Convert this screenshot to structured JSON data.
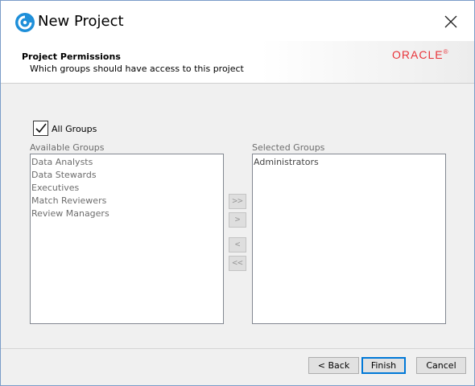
{
  "window": {
    "title": "New Project"
  },
  "header": {
    "title": "Project Permissions",
    "subtitle": "Which groups should have access to this project",
    "logo_text": "ORACLE"
  },
  "all_groups": {
    "label": "All Groups",
    "checked": true
  },
  "available": {
    "label": "Available Groups",
    "items": [
      "Data Analysts",
      "Data Stewards",
      "Executives",
      "Match Reviewers",
      "Review Managers"
    ]
  },
  "selected": {
    "label": "Selected Groups",
    "items": [
      "Administrators"
    ]
  },
  "move_buttons": {
    "add_all": ">>",
    "add": ">",
    "remove": "<",
    "remove_all": "<<"
  },
  "footer": {
    "back": "< Back",
    "finish": "Finish",
    "cancel": "Cancel"
  },
  "colors": {
    "brand": "#e8343a",
    "app_icon": "#1e8fd9",
    "focus": "#0078d7"
  }
}
